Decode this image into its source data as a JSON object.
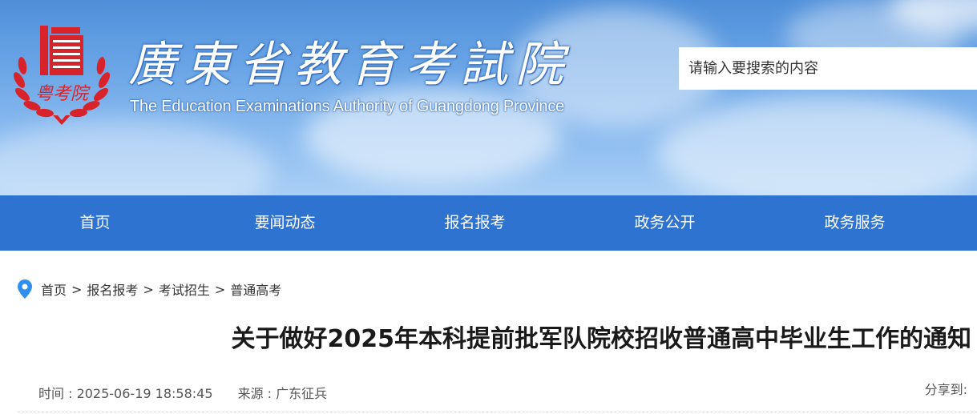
{
  "header": {
    "site_title": "廣東省教育考試院",
    "site_subtitle": "The Education Examinations Authority of Guangdong Province",
    "emblem_text": "粤考院",
    "brand_red": "#d9232a"
  },
  "search": {
    "placeholder": "请输入要搜索的内容"
  },
  "nav": {
    "items": [
      "首页",
      "要闻动态",
      "报名报考",
      "政务公开",
      "政务服务"
    ],
    "background": "#2e73cf"
  },
  "breadcrumb": {
    "items": [
      "首页",
      "报名报考",
      "考试招生",
      "普通高考"
    ],
    "separator": ">"
  },
  "article": {
    "title": "关于做好2025年本科提前批军队院校招收普通高中毕业生工作的通知",
    "time_label": "时间 : 2025-06-19 18:58:45",
    "source_label": "来源 : 广东征兵",
    "share_label": "分享到:"
  },
  "icons": {
    "location": "location-pin-icon"
  }
}
